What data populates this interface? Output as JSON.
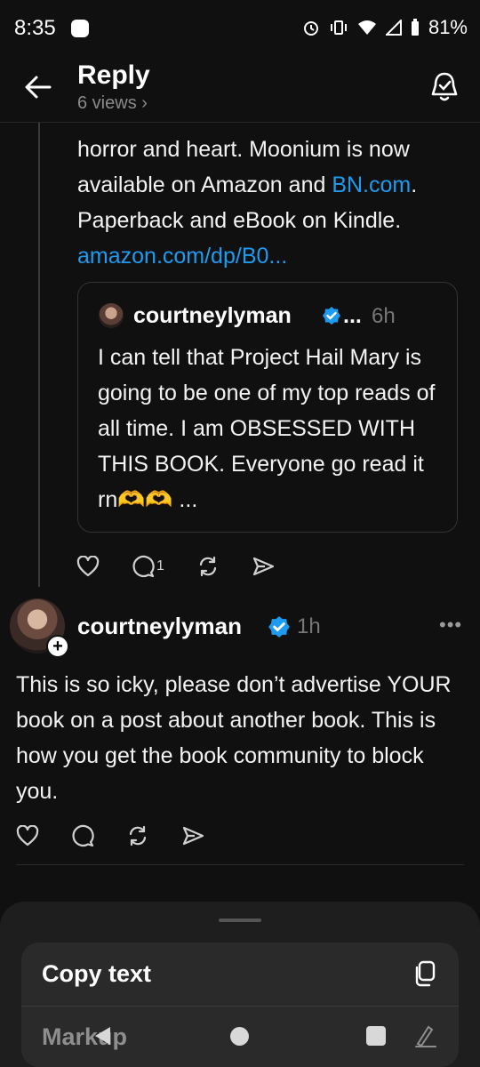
{
  "status_bar": {
    "time": "8:35",
    "battery": "81%"
  },
  "header": {
    "title": "Reply",
    "views": "6 views",
    "views_chevron": "›"
  },
  "parent_post": {
    "lines": [
      "horror and heart. Moonium is now",
      "available on Amazon and ",
      "BN.com",
      ".",
      "Paperback and eBook on Kindle.",
      "amazon.com/dp/B0..."
    ],
    "quote": {
      "username": "courtneylyman",
      "ellipsis": "...",
      "time": "6h",
      "text": "I can tell that Project Hail Mary is going to be one of my top reads of all time. I am OBSESSED WITH THIS BOOK. Everyone go read it rn🫶🫶 ..."
    },
    "actions": {
      "like": "heart-icon",
      "reply_count": "1",
      "repost": "repost-icon",
      "share": "share-icon"
    }
  },
  "reply_post": {
    "username": "courtneylyman",
    "time": "1h",
    "more": "•••",
    "plus": "+",
    "text": "This is so icky, please don’t advertise YOUR book on a post about another book. This is how you get the book community to block you."
  },
  "sheet": {
    "copy_text": "Copy text",
    "markup": "Markup"
  },
  "colors": {
    "background": "#101010",
    "link": "#1d9bf0",
    "verified": "#1d9bf0"
  }
}
